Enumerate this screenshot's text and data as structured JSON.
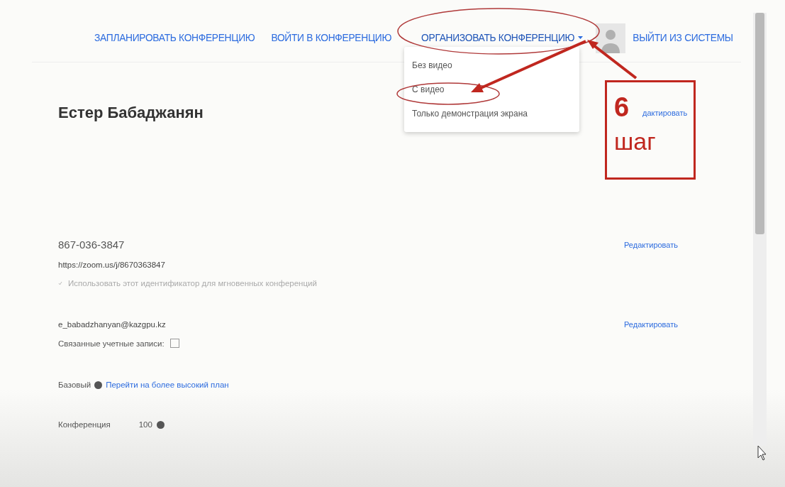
{
  "nav": [
    {
      "label": "ЗАПЛАНИРОВАТЬ КОНФЕРЕНЦИЮ",
      "kind": "link"
    },
    {
      "label": "ВОЙТИ В КОНФЕРЕНЦИЮ",
      "kind": "link"
    },
    {
      "label": "ОРГАНИЗОВАТЬ КОНФЕРЕНЦИЮ",
      "kind": "menu",
      "expanded": true
    },
    {
      "label": "ВЫЙТИ ИЗ СИСТЕМЫ",
      "kind": "avatar-link"
    }
  ],
  "dropdown": [
    "Без видео",
    "С видео",
    "Только демонстрация экрана"
  ],
  "profile": {
    "name": "Естер Бабаджанян",
    "edit": "дактировать"
  },
  "meeting": {
    "id": "867-036-3847",
    "url": "https://zoom.us/j/8670363847",
    "option": "Использовать этот идентификатор для мгновенных конференций",
    "edit": "Редактировать"
  },
  "account": {
    "email": "e_babadzhanyan@kazgpu.kz",
    "linked_label": "Связанные учетные записи:",
    "edit": "Редактировать"
  },
  "plan": {
    "label": "Базовый",
    "upgrade": "Перейти на более высокий план"
  },
  "capacity": {
    "label": "Конференция",
    "value": "100"
  },
  "annotation": {
    "number": "6",
    "word": "шаг"
  }
}
